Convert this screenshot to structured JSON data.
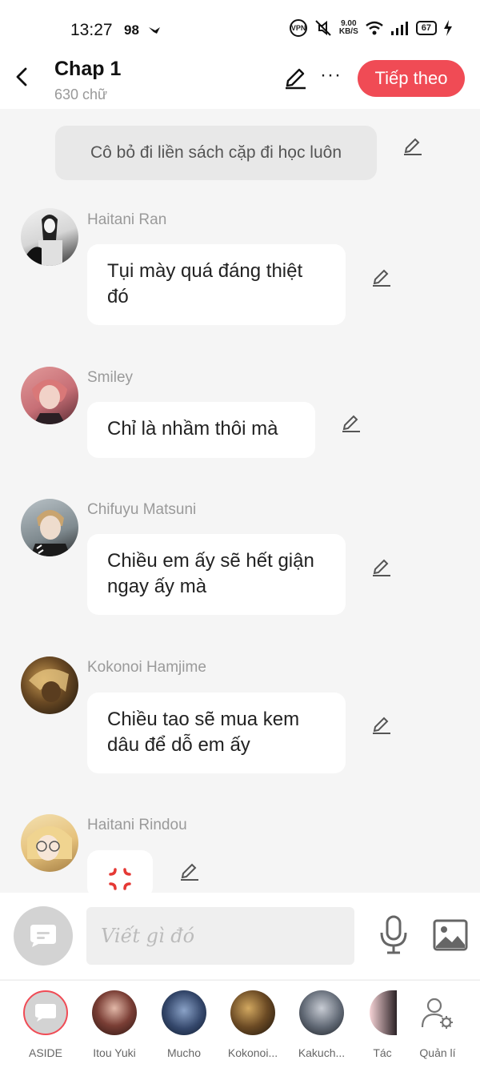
{
  "status": {
    "time": "13:27",
    "notif_count": "98",
    "vpn": "VPN",
    "net_speed_value": "9.00",
    "net_speed_unit": "KB/S",
    "battery": "67"
  },
  "header": {
    "title": "Chap 1",
    "subtitle": "630 chữ",
    "next_label": "Tiếp theo",
    "more": "···"
  },
  "narration": "Cô bỏ đi liền sách cặp đi học luôn",
  "messages": [
    {
      "name": "Haitani Ran",
      "text": "Tụi mày quá đáng thiệt đó"
    },
    {
      "name": "Smiley",
      "text": "Chỉ là nhầm thôi mà"
    },
    {
      "name": "Chifuyu Matsuni",
      "text": "Chiều em ấy sẽ hết giận ngay ấy mà"
    },
    {
      "name": "Kokonoi Hamjime",
      "text": "Chiều tao sẽ mua kem dâu để dỗ em ấy"
    },
    {
      "name": "Haitani Rindou",
      "sticker": "angry-mark-icon"
    }
  ],
  "input": {
    "placeholder": "Viết gì đó"
  },
  "characters": [
    {
      "label": "ASIDE"
    },
    {
      "label": "Itou Yuki"
    },
    {
      "label": "Mucho"
    },
    {
      "label": "Kokonoi..."
    },
    {
      "label": "Kakuch..."
    },
    {
      "label": "Tác"
    },
    {
      "label": "Quản lí"
    }
  ],
  "colors": {
    "accent": "#f04b55",
    "background": "#f5f5f5",
    "bubble": "#ffffff",
    "narration_bg": "#e8e8e8"
  }
}
